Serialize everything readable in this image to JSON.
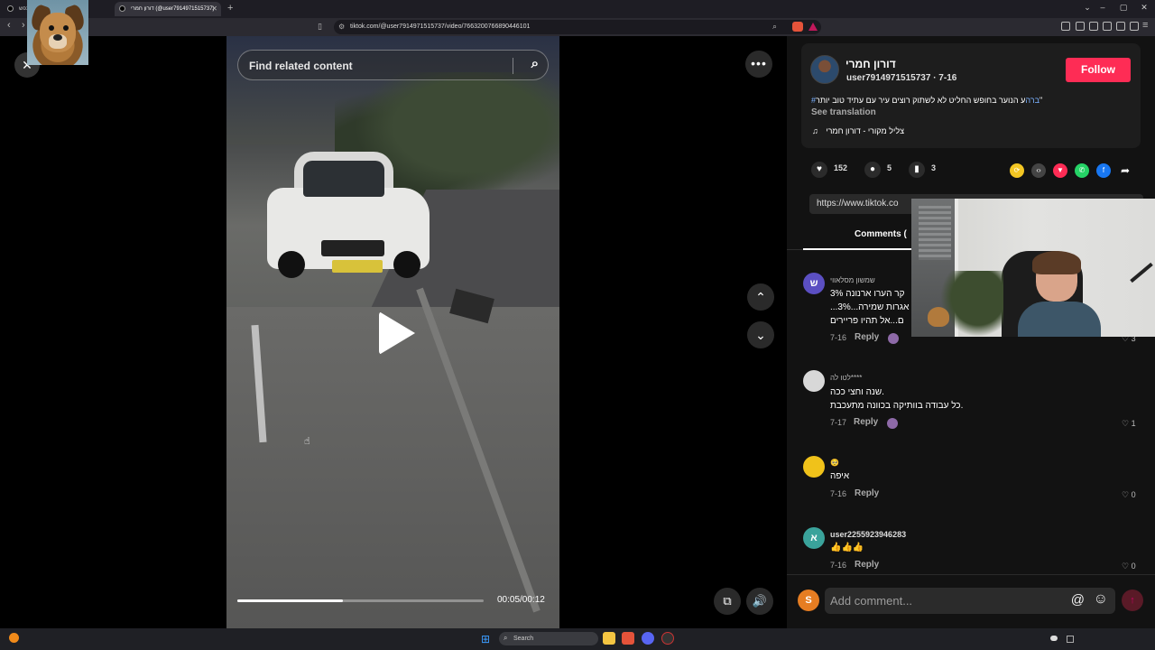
{
  "browser": {
    "tabs": [
      {
        "title": "חה נפש"
      },
      {
        "title": "דורון חמרי (@user7914971515737)"
      }
    ],
    "url": "tiktok.com/@user7914971515737/video/7663200766890446101",
    "new_tab_label": "+",
    "window_controls": [
      "⌄",
      "–",
      "▢",
      "✕"
    ]
  },
  "video": {
    "search_placeholder": "Find related content",
    "current_time": "00:05",
    "duration": "00:12",
    "time_display": "00:05/00:12",
    "progress_fraction": 0.43
  },
  "author": {
    "name": "דורון חמרי",
    "handle_date": "user7914971515737 · 7-16",
    "follow_label": "Follow",
    "caption_hashtag": "#ברה",
    "caption_text": "ע הנוער בחופש החליט לא לשתוק רוצים עיר עם עתיד טוב יותר\"",
    "see_translation": "See translation",
    "music": "צליל מקורי - דורון חמרי"
  },
  "stats": {
    "likes": "152",
    "comments": "5",
    "saves": "3"
  },
  "share_link": "https://www.tiktok.co",
  "tabs": {
    "comments_label": "Comments ("
  },
  "comments": [
    {
      "avatar_letter": "ש",
      "avatar_color": "#5b4fc2",
      "name": "שמשון מסלאווי",
      "lines": [
        "קר הערו ארנונה 3%",
        "...3%...אגרות שמירה",
        "ם...אל תהיו פריירים"
      ],
      "date": "7-16",
      "reply": "Reply",
      "likes": "3"
    },
    {
      "avatar_letter": "",
      "avatar_color": "#d8d8d8",
      "name": "לטו לה****",
      "lines": [
        "שנה וחצי ככה.",
        "כל עבודה בוותיקה בכוונה מתעכבת."
      ],
      "date": "7-17",
      "reply": "Reply",
      "likes": "1"
    },
    {
      "avatar_letter": "",
      "avatar_color": "#f0c21a",
      "name": "🥺",
      "lines": [
        "איפה"
      ],
      "date": "7-16",
      "reply": "Reply",
      "likes": "0"
    },
    {
      "avatar_letter": "א",
      "avatar_color": "#3aa39b",
      "name": "user2255923946283",
      "lines": [
        "👍👍👍"
      ],
      "date": "7-16",
      "reply": "Reply",
      "likes": "0"
    }
  ],
  "comment_box": {
    "avatar_letter": "S",
    "placeholder": "Add comment..."
  },
  "taskbar": {
    "search_placeholder": "Search"
  },
  "icons": {
    "close": "✕",
    "more": "•••",
    "up": "⌃",
    "down": "⌄",
    "search": "⌕",
    "volume": "🔊",
    "at": "@",
    "emoji": "☺",
    "send": "↑",
    "heart": "♥",
    "comment": "💬",
    "bookmark": "🔖",
    "music": "♫"
  },
  "colors": {
    "follow": "#fe2c55",
    "hashtag": "#7ab1ff"
  }
}
